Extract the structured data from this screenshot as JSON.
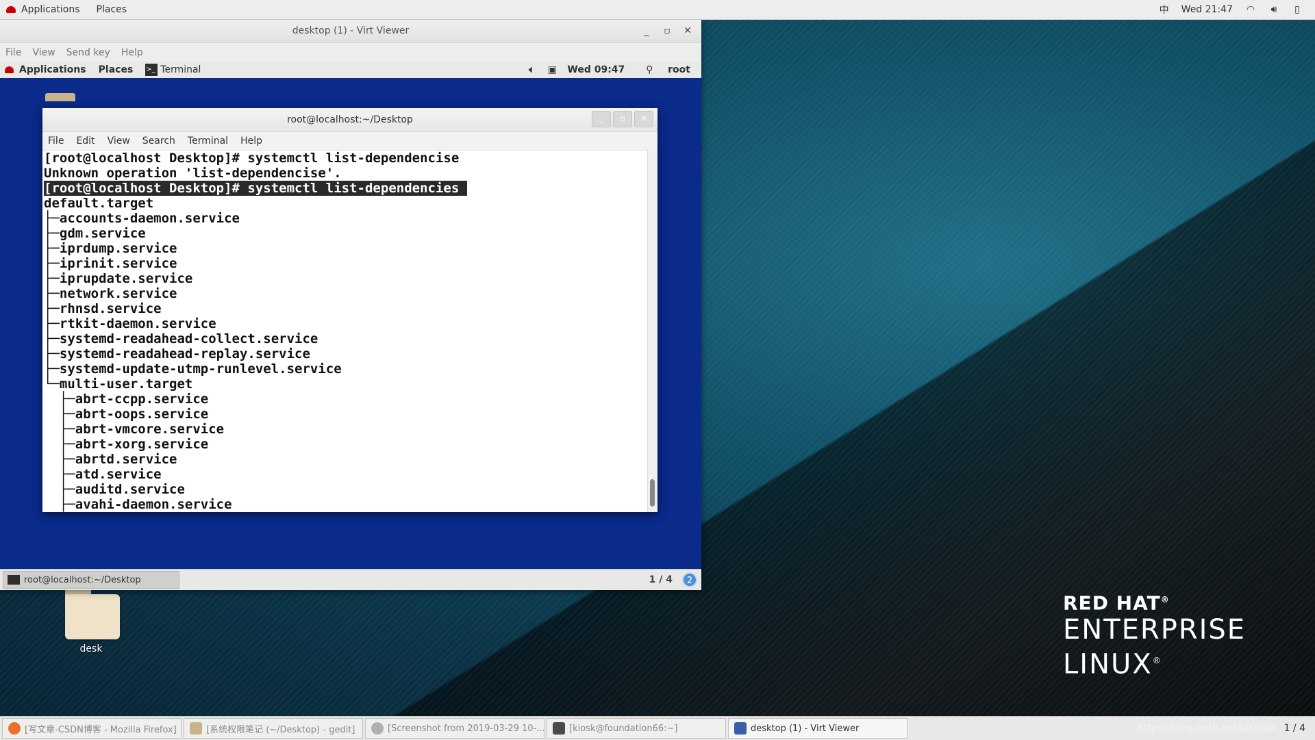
{
  "host_topbar": {
    "applications": "Applications",
    "places": "Places",
    "input_method": "中",
    "clock": "Wed 21:47"
  },
  "virt_viewer": {
    "title": "desktop (1) - Virt Viewer",
    "menu": [
      "File",
      "View",
      "Send key",
      "Help"
    ]
  },
  "guest_topbar": {
    "applications": "Applications",
    "places": "Places",
    "terminal": "Terminal",
    "clock": "Wed 09:47",
    "user": "root"
  },
  "terminal": {
    "title": "root@localhost:~/Desktop",
    "menu": [
      "File",
      "Edit",
      "View",
      "Search",
      "Terminal",
      "Help"
    ],
    "lines": [
      "[root@localhost Desktop]# systemctl list-dependencise",
      "Unknown operation 'list-dependencise'.",
      "[root@localhost Desktop]# systemctl list-dependencies ",
      "default.target",
      "├─accounts-daemon.service",
      "├─gdm.service",
      "├─iprdump.service",
      "├─iprinit.service",
      "├─iprupdate.service",
      "├─network.service",
      "├─rhnsd.service",
      "├─rtkit-daemon.service",
      "├─systemd-readahead-collect.service",
      "├─systemd-readahead-replay.service",
      "├─systemd-update-utmp-runlevel.service",
      "└─multi-user.target",
      "  ├─abrt-ccpp.service",
      "  ├─abrt-oops.service",
      "  ├─abrt-vmcore.service",
      "  ├─abrt-xorg.service",
      "  ├─abrtd.service",
      "  ├─atd.service",
      "  ├─auditd.service",
      "  ├─avahi-daemon.service"
    ]
  },
  "guest_bottom": {
    "task": "root@localhost:~/Desktop",
    "workspace": "1 / 4",
    "notifications": "2"
  },
  "desktop": {
    "folder_label": "desk",
    "logo_line1": "RED HAT",
    "logo_line2": "ENTERPRISE",
    "logo_line3": "LINUX"
  },
  "taskbar": {
    "tasks": [
      "[写文章-CSDN博客 - Mozilla Firefox]",
      "[系统权限笔记 (~/Desktop) - gedit]",
      "[Screenshot from 2019-03-29 10-...",
      "[kiosk@foundation66:~]",
      "desktop (1) - Virt Viewer"
    ],
    "watermark": "https://blog.csdn.net/luchuan",
    "workspace": "1 / 4"
  }
}
